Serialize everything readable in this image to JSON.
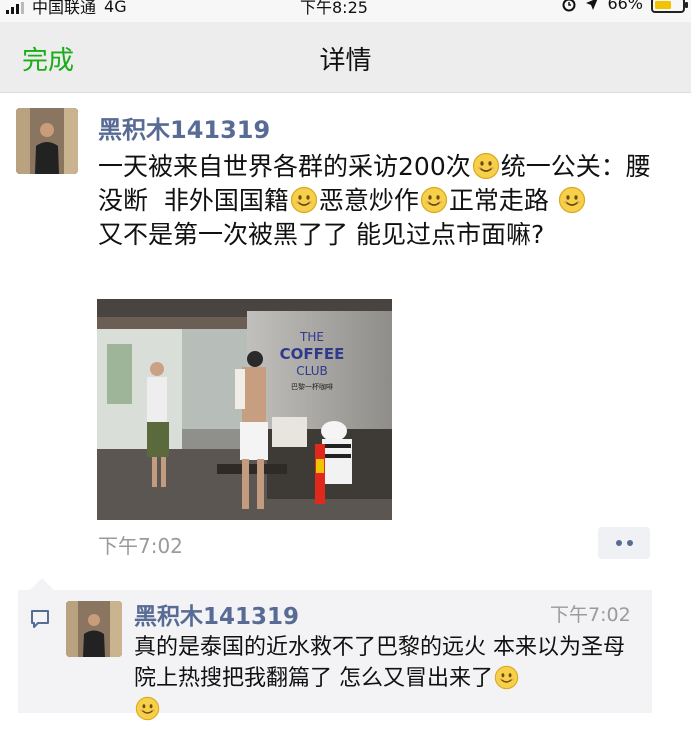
{
  "status_bar": {
    "carrier": "中国联通",
    "network": "4G",
    "time": "下午8:25",
    "battery": "66%",
    "battery_level": 0.66
  },
  "nav": {
    "done_label": "完成",
    "title": "详情"
  },
  "post": {
    "author": "黑积木141319",
    "text_segments": [
      "一天被来自世界各群的采访200次",
      "统一公关：腰没断  非外国国籍",
      "恶意炒作",
      "正常走路 ",
      "\n又不是第一次被黑了了 能见过点市面嘛?"
    ],
    "emoji_name": "smile-emoji",
    "photo": {
      "sign_line1": "THE",
      "sign_line2": "COFFEE",
      "sign_line3": "CLUB",
      "sign_line4": "巴黎一杯咖啡"
    },
    "time": "下午7:02"
  },
  "comment": {
    "author": "黑积木141319",
    "time": "下午7:02",
    "text_segments": [
      "真的是泰国的近水救不了巴黎的远火 本来以为圣母院上热搜把我翻篇了 怎么又冒出来了",
      "\n"
    ]
  },
  "colors": {
    "accent_green": "#1aad19",
    "link_blue": "#576b95",
    "nav_bg": "#ededed",
    "comment_bg": "#f3f3f5"
  }
}
